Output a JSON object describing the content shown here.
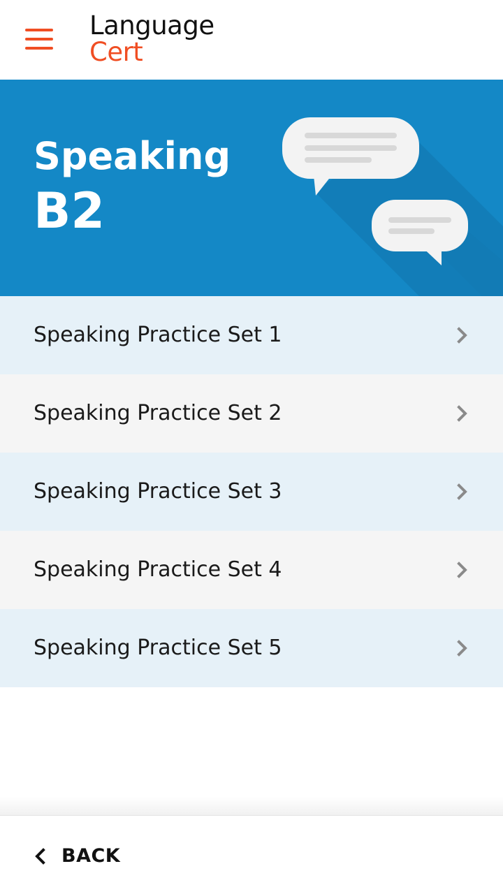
{
  "header": {
    "menu_icon": "hamburger-menu-icon",
    "logo_line1": "Language",
    "logo_line2": "Cert",
    "brand_color": "#f04e23"
  },
  "hero": {
    "title": "Speaking",
    "level": "B2",
    "background_color": "#1488c6",
    "illustration_icon": "chat-bubbles-icon"
  },
  "list": {
    "items": [
      {
        "label": "Speaking Practice Set 1",
        "icon": "chevron-right-icon"
      },
      {
        "label": "Speaking Practice Set 2",
        "icon": "chevron-right-icon"
      },
      {
        "label": "Speaking Practice Set 3",
        "icon": "chevron-right-icon"
      },
      {
        "label": "Speaking Practice Set 4",
        "icon": "chevron-right-icon"
      },
      {
        "label": "Speaking Practice Set 5",
        "icon": "chevron-right-icon"
      }
    ]
  },
  "footer": {
    "back_label": "BACK",
    "back_icon": "chevron-left-icon"
  }
}
